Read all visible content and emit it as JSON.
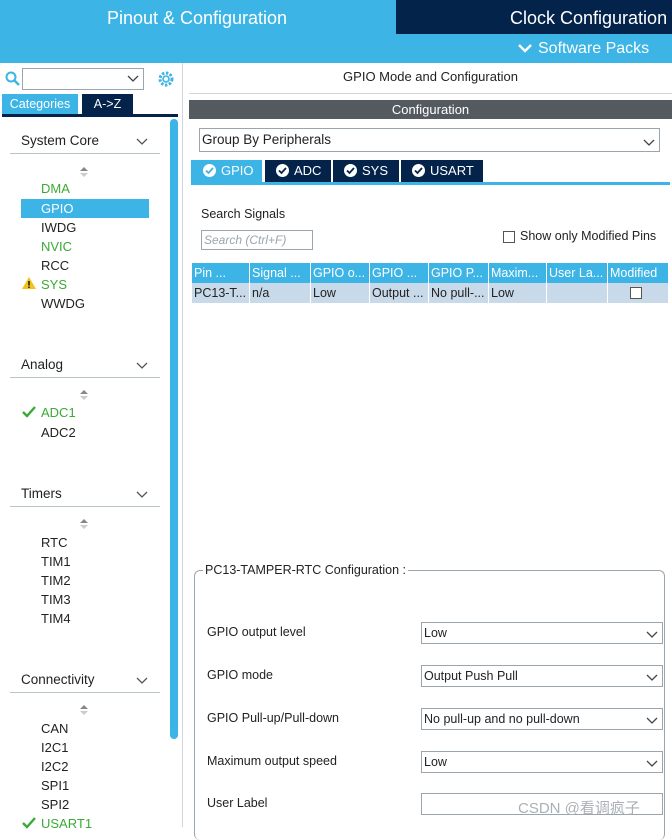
{
  "topbar": {
    "pinout_tab": "Pinout & Configuration",
    "clock_tab": "Clock Configuration",
    "software_packs": "Software Packs"
  },
  "left": {
    "search_value": "",
    "tabs": [
      "Categories",
      "A->Z"
    ],
    "groups": [
      {
        "title": "System Core",
        "items": [
          "DMA",
          "GPIO",
          "IWDG",
          "NVIC",
          "RCC",
          "SYS",
          "WWDG"
        ]
      },
      {
        "title": "Analog",
        "items": [
          "ADC1",
          "ADC2"
        ]
      },
      {
        "title": "Timers",
        "items": [
          "RTC",
          "TIM1",
          "TIM2",
          "TIM3",
          "TIM4"
        ]
      },
      {
        "title": "Connectivity",
        "items": [
          "CAN",
          "I2C1",
          "I2C2",
          "SPI1",
          "SPI2",
          "USART1"
        ]
      }
    ]
  },
  "right": {
    "mode_title": "GPIO Mode and Configuration",
    "configuration_bar": "Configuration",
    "group_select": "Group By Peripherals",
    "peripheral_tabs": [
      "GPIO",
      "ADC",
      "SYS",
      "USART"
    ],
    "search_signals_label": "Search Signals",
    "search_placeholder": "Search (Ctrl+F)",
    "show_modified_label": "Show only Modified Pins",
    "table": {
      "headers": [
        "Pin ...",
        "Signal ...",
        "GPIO o...",
        "GPIO ...",
        "GPIO P...",
        "Maxim...",
        "User La...",
        "Modified"
      ],
      "row": [
        "PC13-T...",
        "n/a",
        "Low",
        "Output ...",
        "No pull-...",
        "Low",
        "",
        ""
      ]
    },
    "config": {
      "legend": "PC13-TAMPER-RTC Configuration :",
      "fields": [
        {
          "label": "GPIO output level",
          "value": "Low"
        },
        {
          "label": "GPIO mode",
          "value": "Output Push Pull"
        },
        {
          "label": "GPIO Pull-up/Pull-down",
          "value": "No pull-up and no pull-down"
        },
        {
          "label": "Maximum output speed",
          "value": "Low"
        },
        {
          "label": "User Label",
          "value": ""
        }
      ]
    }
  },
  "watermark": "CSDN @看调疯子",
  "colors": {
    "accent": "#3cb4e5",
    "dark": "#03234b",
    "ok_green": "#3aaa35",
    "warn_yellow": "#f0c419"
  }
}
